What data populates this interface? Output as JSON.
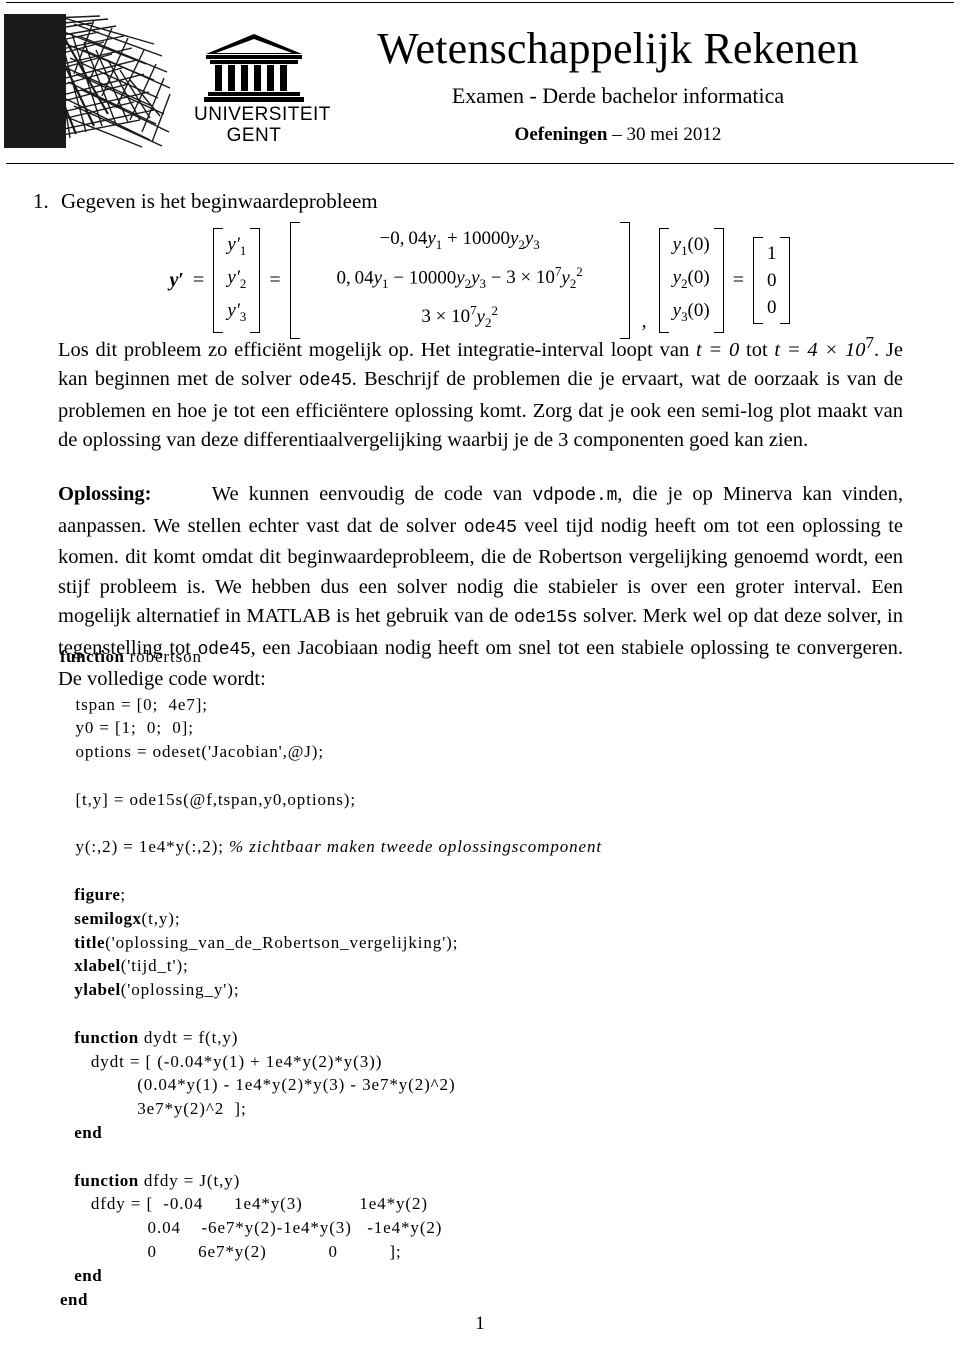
{
  "header": {
    "title": "Wetenschappelijk Rekenen",
    "subtitle": "Examen - Derde bachelor informatica",
    "date_label_bold": "Oefeningen",
    "date_label_rest": "– 30 mei 2012",
    "logo": {
      "line1": "UNIVERSITEIT",
      "line2": "GENT"
    }
  },
  "question": {
    "number": "1.",
    "prompt": "Gegeven is het beginwaardeprobleem"
  },
  "equation": {
    "lhs_symbol": "y′",
    "vector_y": [
      "y′1",
      "y′2",
      "y′3"
    ],
    "rhs_rows": [
      "−0, 04y1 + 10000y2y3",
      "0, 04y1 − 10000y2y3 − 3 × 10⁷y2²",
      "3 × 10⁷y2²"
    ],
    "initial_vector": [
      "y1(0)",
      "y2(0)",
      "y3(0)"
    ],
    "initial_values": [
      "1",
      "0",
      "0"
    ]
  },
  "paragraphs": {
    "p1_a": "Los dit probleem zo efficiënt mogelijk op. Het integratie-interval loopt van ",
    "p1_t0": "t = 0",
    "p1_b": " tot ",
    "p1_t1": "t = 4 × 10",
    "p1_t1sup": "7",
    "p1_c": ". Je kan beginnen met de solver ",
    "p1_code1": "ode45",
    "p1_d": ". Beschrijf de problemen die je ervaart, wat de oorzaak is van de problemen en hoe je tot een efficiëntere oplossing komt. Zorg dat je ook een semi-log plot maakt van de oplossing van deze differentiaalvergelijking waarbij je de 3 componenten goed kan zien.",
    "p2_label": "Oplossing:",
    "p2_a": "We kunnen eenvoudig de code van ",
    "p2_code1": "vdpode.m",
    "p2_b": ", die je op Minerva kan vinden, aanpassen. We stellen echter vast dat de solver ",
    "p2_code2": "ode45",
    "p2_c": " veel tijd nodig heeft om tot een oplossing te komen. dit komt omdat dit beginwaardeprobleem, die de Robertson vergelijking genoemd wordt, een stijf probleem is. We hebben dus een solver nodig die stabieler is over een groter interval. Een mogelijk alternatief in MATLAB is het gebruik van de ",
    "p2_code3": "ode15s",
    "p2_d": " solver. Merk wel op dat deze solver, in tegenstelling tot ",
    "p2_code4": "ode45",
    "p2_e": ", een Jacobiaan nodig heeft om snel tot een stabiele oplossing te convergeren. De volledige code wordt:"
  },
  "code_listing": {
    "lines": [
      {
        "kw": "function",
        "rest": " robertson"
      },
      {
        "blank": true
      },
      {
        "kw": "",
        "rest": "   tspan = [0;  4e7];"
      },
      {
        "kw": "",
        "rest": "   y0 = [1;  0;  0];"
      },
      {
        "kw": "",
        "rest": "   options = odeset('Jacobian',@J);"
      },
      {
        "blank": true
      },
      {
        "kw": "",
        "rest": "   [t,y] = ode15s(@f,tspan,y0,options);"
      },
      {
        "blank": true
      },
      {
        "kw": "",
        "rest": "   y(:,2) = 1e4*y(:,2); ",
        "cmt": "% zichtbaar maken tweede oplossingscomponent"
      },
      {
        "blank": true
      },
      {
        "kw": "   figure",
        "rest": ";"
      },
      {
        "kw": "   semilogx",
        "rest": "(t,y);"
      },
      {
        "kw": "   title",
        "rest": "('oplossing_van_de_Robertson_vergelijking');"
      },
      {
        "kw": "   xlabel",
        "rest": "('tijd_t');"
      },
      {
        "kw": "   ylabel",
        "rest": "('oplossing_y');"
      },
      {
        "blank": true
      },
      {
        "kw": "   function",
        "rest": " dydt = f(t,y)"
      },
      {
        "kw": "",
        "rest": "      dydt = [ (-0.04*y(1) + 1e4*y(2)*y(3))"
      },
      {
        "kw": "",
        "rest": "               (0.04*y(1) - 1e4*y(2)*y(3) - 3e7*y(2)^2)"
      },
      {
        "kw": "",
        "rest": "               3e7*y(2)^2  ];"
      },
      {
        "kw": "   end",
        "rest": ""
      },
      {
        "blank": true
      },
      {
        "kw": "   function",
        "rest": " dfdy = J(t,y)"
      },
      {
        "kw": "",
        "rest": "      dfdy = [  -0.04      1e4*y(3)           1e4*y(2)"
      },
      {
        "kw": "",
        "rest": "                 0.04    -6e7*y(2)-1e4*y(3)   -1e4*y(2)"
      },
      {
        "kw": "",
        "rest": "                 0        6e7*y(2)            0          ];"
      },
      {
        "kw": "   end",
        "rest": ""
      },
      {
        "kw": "end",
        "rest": ""
      }
    ]
  },
  "footer": {
    "page_number": "1"
  }
}
